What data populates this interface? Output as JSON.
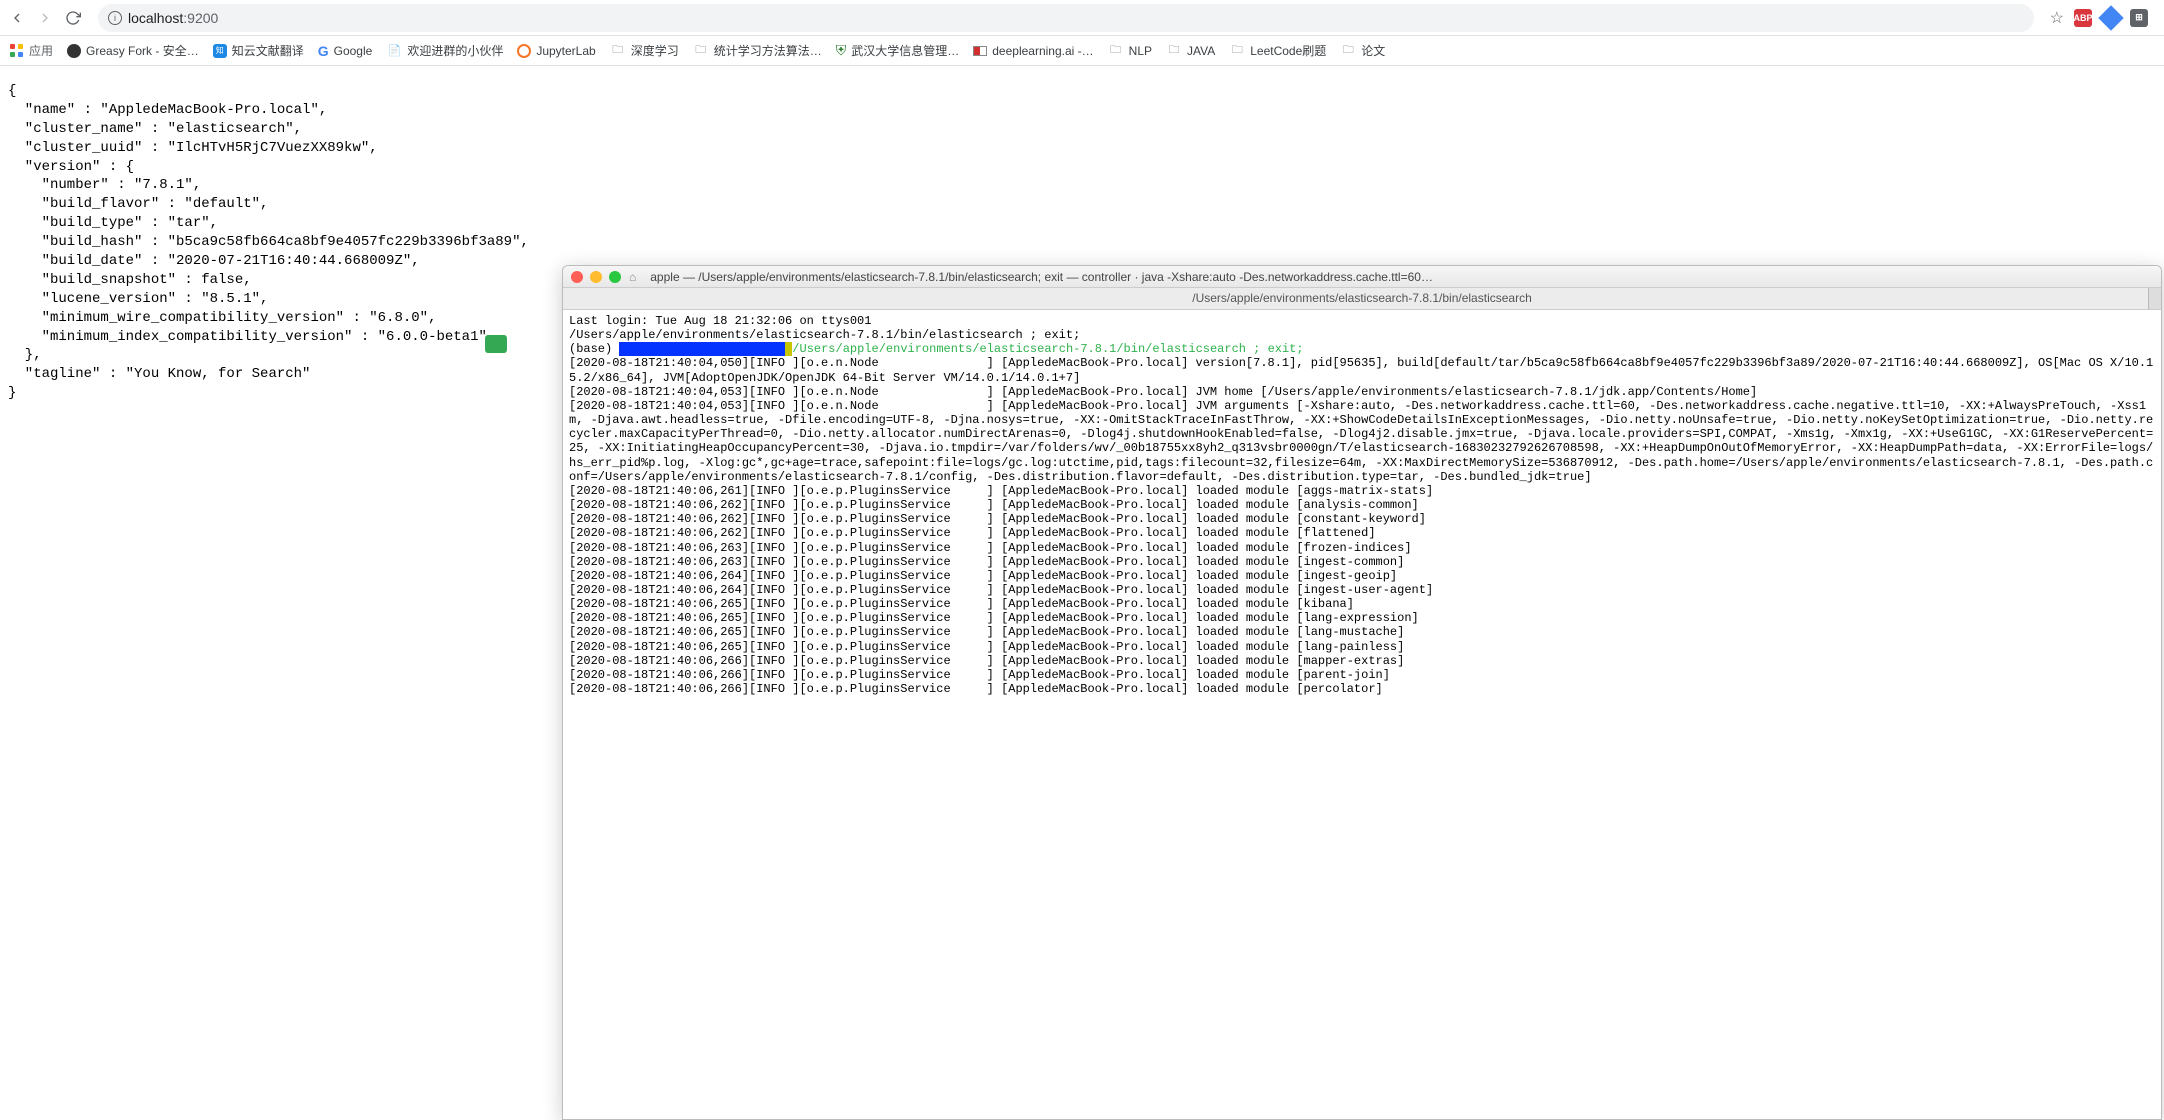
{
  "browser": {
    "url_host": "localhost",
    "url_port": ":9200",
    "extensions": {
      "abp": "ABP"
    }
  },
  "bookmarks": {
    "apps": "应用",
    "items": [
      "Greasy Fork - 安全…",
      "知云文献翻译",
      "Google",
      "欢迎进群的小伙伴",
      "JupyterLab",
      "深度学习",
      "统计学习方法算法…",
      "武汉大学信息管理…",
      "deeplearning.ai -…",
      "NLP",
      "JAVA",
      "LeetCode刷题",
      "论文"
    ]
  },
  "json_body": "{\n  \"name\" : \"AppledeMacBook-Pro.local\",\n  \"cluster_name\" : \"elasticsearch\",\n  \"cluster_uuid\" : \"IlcHTvH5RjC7VuezXX89kw\",\n  \"version\" : {\n    \"number\" : \"7.8.1\",\n    \"build_flavor\" : \"default\",\n    \"build_type\" : \"tar\",\n    \"build_hash\" : \"b5ca9c58fb664ca8bf9e4057fc229b3396bf3a89\",\n    \"build_date\" : \"2020-07-21T16:40:44.668009Z\",\n    \"build_snapshot\" : false,\n    \"lucene_version\" : \"8.5.1\",\n    \"minimum_wire_compatibility_version\" : \"6.8.0\",\n    \"minimum_index_compatibility_version\" : \"6.0.0-beta1\"\n  },\n  \"tagline\" : \"You Know, for Search\"\n}",
  "terminal": {
    "title": "apple — /Users/apple/environments/elasticsearch-7.8.1/bin/elasticsearch; exit — controller · java -Xshare:auto -Des.networkaddress.cache.ttl=60…",
    "tab": "/Users/apple/environments/elasticsearch-7.8.1/bin/elasticsearch",
    "line_login": "Last login: Tue Aug 18 21:32:06 on ttys001",
    "line_path": "/Users/apple/environments/elasticsearch-7.8.1/bin/elasticsearch ; exit;",
    "prompt_base": "(base) ",
    "prompt_hidden": "███████████████████████",
    "prompt_q": "▯",
    "prompt_cmd": "/Users/apple/environments/elasticsearch-7.8.1/bin/elasticsearch ; exit;",
    "log_block": "[2020-08-18T21:40:04,050][INFO ][o.e.n.Node               ] [AppledeMacBook-Pro.local] version[7.8.1], pid[95635], build[default/tar/b5ca9c58fb664ca8bf9e4057fc229b3396bf3a89/2020-07-21T16:40:44.668009Z], OS[Mac OS X/10.15.2/x86_64], JVM[AdoptOpenJDK/OpenJDK 64-Bit Server VM/14.0.1/14.0.1+7]\n[2020-08-18T21:40:04,053][INFO ][o.e.n.Node               ] [AppledeMacBook-Pro.local] JVM home [/Users/apple/environments/elasticsearch-7.8.1/jdk.app/Contents/Home]\n[2020-08-18T21:40:04,053][INFO ][o.e.n.Node               ] [AppledeMacBook-Pro.local] JVM arguments [-Xshare:auto, -Des.networkaddress.cache.ttl=60, -Des.networkaddress.cache.negative.ttl=10, -XX:+AlwaysPreTouch, -Xss1m, -Djava.awt.headless=true, -Dfile.encoding=UTF-8, -Djna.nosys=true, -XX:-OmitStackTraceInFastThrow, -XX:+ShowCodeDetailsInExceptionMessages, -Dio.netty.noUnsafe=true, -Dio.netty.noKeySetOptimization=true, -Dio.netty.recycler.maxCapacityPerThread=0, -Dio.netty.allocator.numDirectArenas=0, -Dlog4j.shutdownHookEnabled=false, -Dlog4j2.disable.jmx=true, -Djava.locale.providers=SPI,COMPAT, -Xms1g, -Xmx1g, -XX:+UseG1GC, -XX:G1ReservePercent=25, -XX:InitiatingHeapOccupancyPercent=30, -Djava.io.tmpdir=/var/folders/wv/_00b18755xx8yh2_q313vsbr0000gn/T/elasticsearch-16830232792626708598, -XX:+HeapDumpOnOutOfMemoryError, -XX:HeapDumpPath=data, -XX:ErrorFile=logs/hs_err_pid%p.log, -Xlog:gc*,gc+age=trace,safepoint:file=logs/gc.log:utctime,pid,tags:filecount=32,filesize=64m, -XX:MaxDirectMemorySize=536870912, -Des.path.home=/Users/apple/environments/elasticsearch-7.8.1, -Des.path.conf=/Users/apple/environments/elasticsearch-7.8.1/config, -Des.distribution.flavor=default, -Des.distribution.type=tar, -Des.bundled_jdk=true]\n[2020-08-18T21:40:06,261][INFO ][o.e.p.PluginsService     ] [AppledeMacBook-Pro.local] loaded module [aggs-matrix-stats]\n[2020-08-18T21:40:06,262][INFO ][o.e.p.PluginsService     ] [AppledeMacBook-Pro.local] loaded module [analysis-common]\n[2020-08-18T21:40:06,262][INFO ][o.e.p.PluginsService     ] [AppledeMacBook-Pro.local] loaded module [constant-keyword]\n[2020-08-18T21:40:06,262][INFO ][o.e.p.PluginsService     ] [AppledeMacBook-Pro.local] loaded module [flattened]\n[2020-08-18T21:40:06,263][INFO ][o.e.p.PluginsService     ] [AppledeMacBook-Pro.local] loaded module [frozen-indices]\n[2020-08-18T21:40:06,263][INFO ][o.e.p.PluginsService     ] [AppledeMacBook-Pro.local] loaded module [ingest-common]\n[2020-08-18T21:40:06,264][INFO ][o.e.p.PluginsService     ] [AppledeMacBook-Pro.local] loaded module [ingest-geoip]\n[2020-08-18T21:40:06,264][INFO ][o.e.p.PluginsService     ] [AppledeMacBook-Pro.local] loaded module [ingest-user-agent]\n[2020-08-18T21:40:06,265][INFO ][o.e.p.PluginsService     ] [AppledeMacBook-Pro.local] loaded module [kibana]\n[2020-08-18T21:40:06,265][INFO ][o.e.p.PluginsService     ] [AppledeMacBook-Pro.local] loaded module [lang-expression]\n[2020-08-18T21:40:06,265][INFO ][o.e.p.PluginsService     ] [AppledeMacBook-Pro.local] loaded module [lang-mustache]\n[2020-08-18T21:40:06,265][INFO ][o.e.p.PluginsService     ] [AppledeMacBook-Pro.local] loaded module [lang-painless]\n[2020-08-18T21:40:06,266][INFO ][o.e.p.PluginsService     ] [AppledeMacBook-Pro.local] loaded module [mapper-extras]\n[2020-08-18T21:40:06,266][INFO ][o.e.p.PluginsService     ] [AppledeMacBook-Pro.local] loaded module [parent-join]\n[2020-08-18T21:40:06,266][INFO ][o.e.p.PluginsService     ] [AppledeMacBook-Pro.local] loaded module [percolator]"
  }
}
